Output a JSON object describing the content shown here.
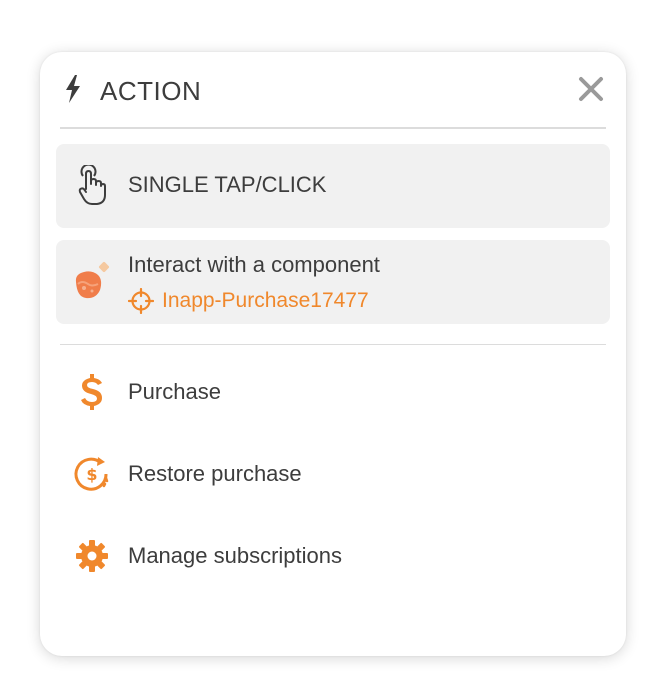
{
  "panel": {
    "title": "ACTION",
    "title_icon": "lightning-bolt-icon",
    "close_icon": "close-icon"
  },
  "trigger": {
    "label": "SINGLE TAP/CLICK",
    "icon": "tap-hand-icon"
  },
  "interaction": {
    "label": "Interact with a component",
    "icon": "component-blob-icon",
    "target_icon": "crosshair-target-icon",
    "target_name": "Inapp-Purchase17477"
  },
  "actions": [
    {
      "label": "Purchase",
      "icon": "dollar-icon"
    },
    {
      "label": "Restore purchase",
      "icon": "restore-dollar-icon"
    },
    {
      "label": "Manage subscriptions",
      "icon": "gear-icon"
    }
  ],
  "colors": {
    "accent": "#f0882c",
    "text": "#3d3d3d",
    "row_background": "#f1f1f1",
    "divider": "#dcdcdc",
    "close": "#9a9a9a"
  }
}
